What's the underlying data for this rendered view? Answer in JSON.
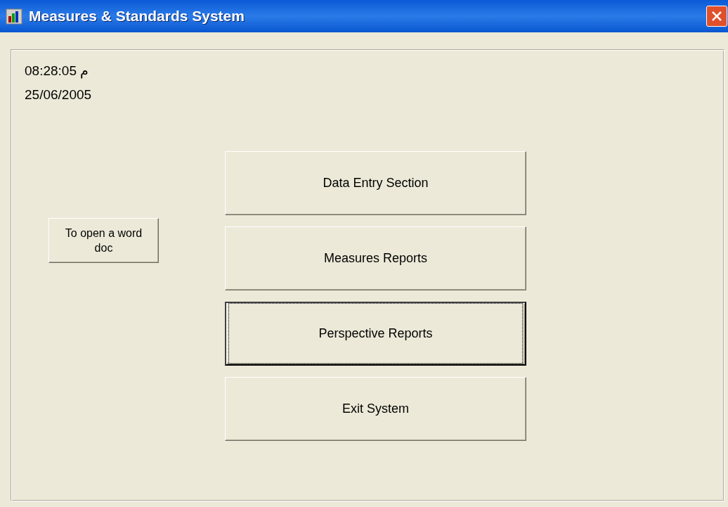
{
  "window": {
    "title": "Measures & Standards System"
  },
  "clock": {
    "time": "08:28:05 م",
    "date": "25/06/2005"
  },
  "side_button": {
    "label": "To open a word doc",
    "focused": false
  },
  "menu_buttons": [
    {
      "label": "Data Entry Section",
      "focused": false
    },
    {
      "label": "Measures Reports",
      "focused": false
    },
    {
      "label": "Perspective Reports",
      "focused": true
    },
    {
      "label": "Exit System",
      "focused": false
    }
  ]
}
